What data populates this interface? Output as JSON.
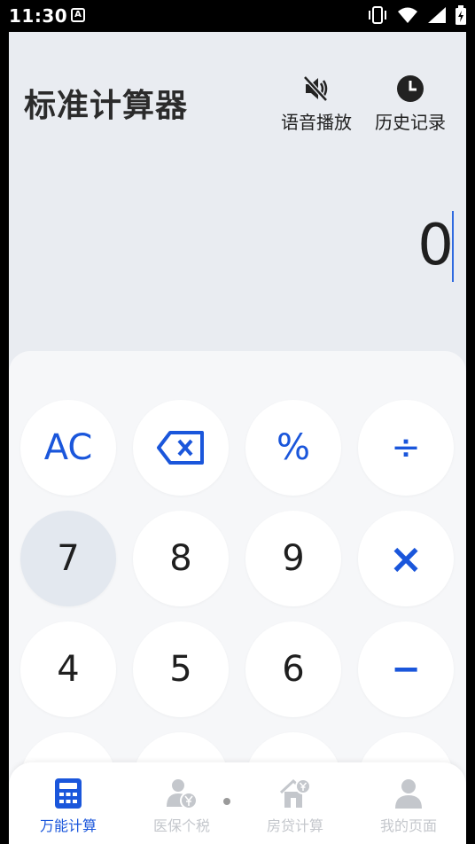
{
  "status_bar": {
    "time": "11:30",
    "notif_letter": "A"
  },
  "header": {
    "title": "标准计算器",
    "voice_label": "语音播放",
    "history_label": "历史记录"
  },
  "display": {
    "value": "0"
  },
  "keys": [
    {
      "label": "AC",
      "type": "op"
    },
    {
      "label": "",
      "type": "op",
      "icon": "backspace-icon"
    },
    {
      "label": "%",
      "type": "op"
    },
    {
      "label": "÷",
      "type": "op"
    },
    {
      "label": "7",
      "type": "num"
    },
    {
      "label": "8",
      "type": "num"
    },
    {
      "label": "9",
      "type": "num"
    },
    {
      "label": "×",
      "type": "op"
    },
    {
      "label": "4",
      "type": "num"
    },
    {
      "label": "5",
      "type": "num"
    },
    {
      "label": "6",
      "type": "num"
    },
    {
      "label": "−",
      "type": "op"
    }
  ],
  "tabs": [
    {
      "label": "万能计算",
      "icon": "calculator-icon",
      "active": true
    },
    {
      "label": "医保个税",
      "icon": "person-yuan-icon",
      "active": false
    },
    {
      "label": "房贷计算",
      "icon": "house-yuan-icon",
      "active": false
    },
    {
      "label": "我的页面",
      "icon": "person-icon",
      "active": false
    }
  ],
  "colors": {
    "accent": "#1a56db",
    "background": "#e9ecf1",
    "keypad": "#f6f7f9",
    "inactive_tab": "#c4c7cc"
  }
}
